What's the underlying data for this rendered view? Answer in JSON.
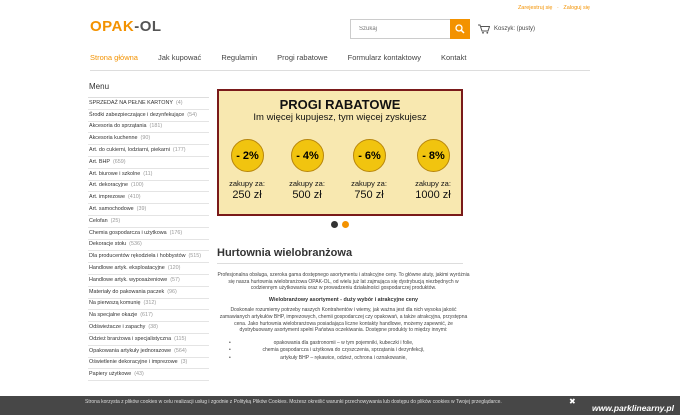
{
  "header": {
    "toplinks": [
      "Zarejestruj się",
      "·",
      "Zaloguj się"
    ],
    "logo_part1": "OPAK",
    "logo_part2": "-OL",
    "search_placeholder": "Szukaj",
    "cart_label": "Koszyk: (pusty)"
  },
  "nav": {
    "items": [
      "Strona główna",
      "Jak kupować",
      "Regulamin",
      "Progi rabatowe",
      "Formularz kontaktowy",
      "Kontakt"
    ],
    "active_index": 0
  },
  "sidebar": {
    "title": "Menu",
    "items": [
      {
        "label": "SPRZEDAŻ NA PEŁNE KARTONY",
        "count": "(4)"
      },
      {
        "label": "Środki zabezpieczające i dezynfekujące",
        "count": "(54)"
      },
      {
        "label": "Akcesoria do sprzątania",
        "count": "(181)"
      },
      {
        "label": "Akcesoria kuchenne",
        "count": "(90)"
      },
      {
        "label": "Art. do cukierni, lodziarni, piekarni",
        "count": "(177)"
      },
      {
        "label": "Art. BHP",
        "count": "(659)"
      },
      {
        "label": "Art. biurowe i szkolne",
        "count": "(11)"
      },
      {
        "label": "Art. dekoracyjne",
        "count": "(100)"
      },
      {
        "label": "Art. imprezowe",
        "count": "(410)"
      },
      {
        "label": "Art. samochodowe",
        "count": "(39)"
      },
      {
        "label": "Celofan",
        "count": "(25)"
      },
      {
        "label": "Chemia gospodarcza i użytkowa",
        "count": "(176)"
      },
      {
        "label": "Dekoracje stołu",
        "count": "(536)"
      },
      {
        "label": "Dla producentów rękodzieła i hobbystów",
        "count": "(515)"
      },
      {
        "label": "Handlowe artyk. eksploatacyjne",
        "count": "(120)"
      },
      {
        "label": "Handlowe artyk. wyposażeniowe",
        "count": "(57)"
      },
      {
        "label": "Materiały do pakowania paczek",
        "count": "(96)"
      },
      {
        "label": "Na pierwszą komunię",
        "count": "(312)"
      },
      {
        "label": "Na specjalne okazje",
        "count": "(617)"
      },
      {
        "label": "Odświeżacze i zapachy",
        "count": "(38)"
      },
      {
        "label": "Odzież branżowa i specjalistyczna",
        "count": "(115)"
      },
      {
        "label": "Opakowania artykuły jednorazowe",
        "count": "(564)"
      },
      {
        "label": "Oświetlenie dekoracyjne i imprezowe",
        "count": "(3)"
      },
      {
        "label": "Papiery użytkowe",
        "count": "(43)"
      }
    ]
  },
  "banner": {
    "title": "PROGI RABATOWE",
    "subtitle": "Im więcej kupujesz, tym więcej zyskujesz",
    "tiers": [
      {
        "discount": "- 2%",
        "label": "zakupy za:",
        "amount": "250 zł"
      },
      {
        "discount": "- 4%",
        "label": "zakupy za:",
        "amount": "500 zł"
      },
      {
        "discount": "- 6%",
        "label": "zakupy za:",
        "amount": "750 zł"
      },
      {
        "discount": "- 8%",
        "label": "zakupy za:",
        "amount": "1000 zł"
      }
    ],
    "slide_active": 1,
    "colors": {
      "bg": "#f8e8b0",
      "border": "#7a1a1a",
      "disc": "#f1c40f"
    }
  },
  "content": {
    "title": "Hurtownia wielobranżowa",
    "intro": "Profesjonalna obsługa, szeroka gama dostępnego asortymentu i atrakcyjne ceny. To główne atuty, jakimi wyróżnia się nasza hurtownia wielobranżowa OPAK-OL, od wielu już lat zajmująca się dystrybucją niezbędnych w codziennym użytkowaniu oraz w prowadzeniu działalności gospodarczej produktów.",
    "subheading": "Wielobranżowy asortyment - duży wybór i atrakcyjne ceny",
    "paragraph2": "Doskonale rozumiemy potrzeby naszych Kontrahentów i wiemy, jak ważna jest dla nich wysoka jakość zamawianych artykułów BHP, imprezowych, chemii gospodarczej czy opakowań, a także atrakcyjna, przystępna cena. Jako hurtownia wielobranżowa posiadająca liczne kontakty handlowe, możemy zapewnić, że dystrybuowany asortyment spełni Państwa oczekiwania. Dostępne produkty to między innymi:",
    "list": [
      "opakowania dla gastronomii – w tym pojemniki, kubeczki i folie,",
      "chemia gospodarcza i użytkowa do czyszczenia, sprzątania i dezynfekcji,",
      "artykuły BHP – rękawice, odzież, ochrona i oznakowanie,"
    ]
  },
  "cookie": {
    "text": "Strona korzysta z plików cookies w celu realizacji usług i zgodnie z Polityką Plików Cookies. Możesz określić warunki przechowywania lub dostępu do plików cookies w Twojej przeglądarce.",
    "close": "✖"
  },
  "watermark": "www.parklinearny.pl",
  "colors": {
    "accent": "#f39200"
  }
}
